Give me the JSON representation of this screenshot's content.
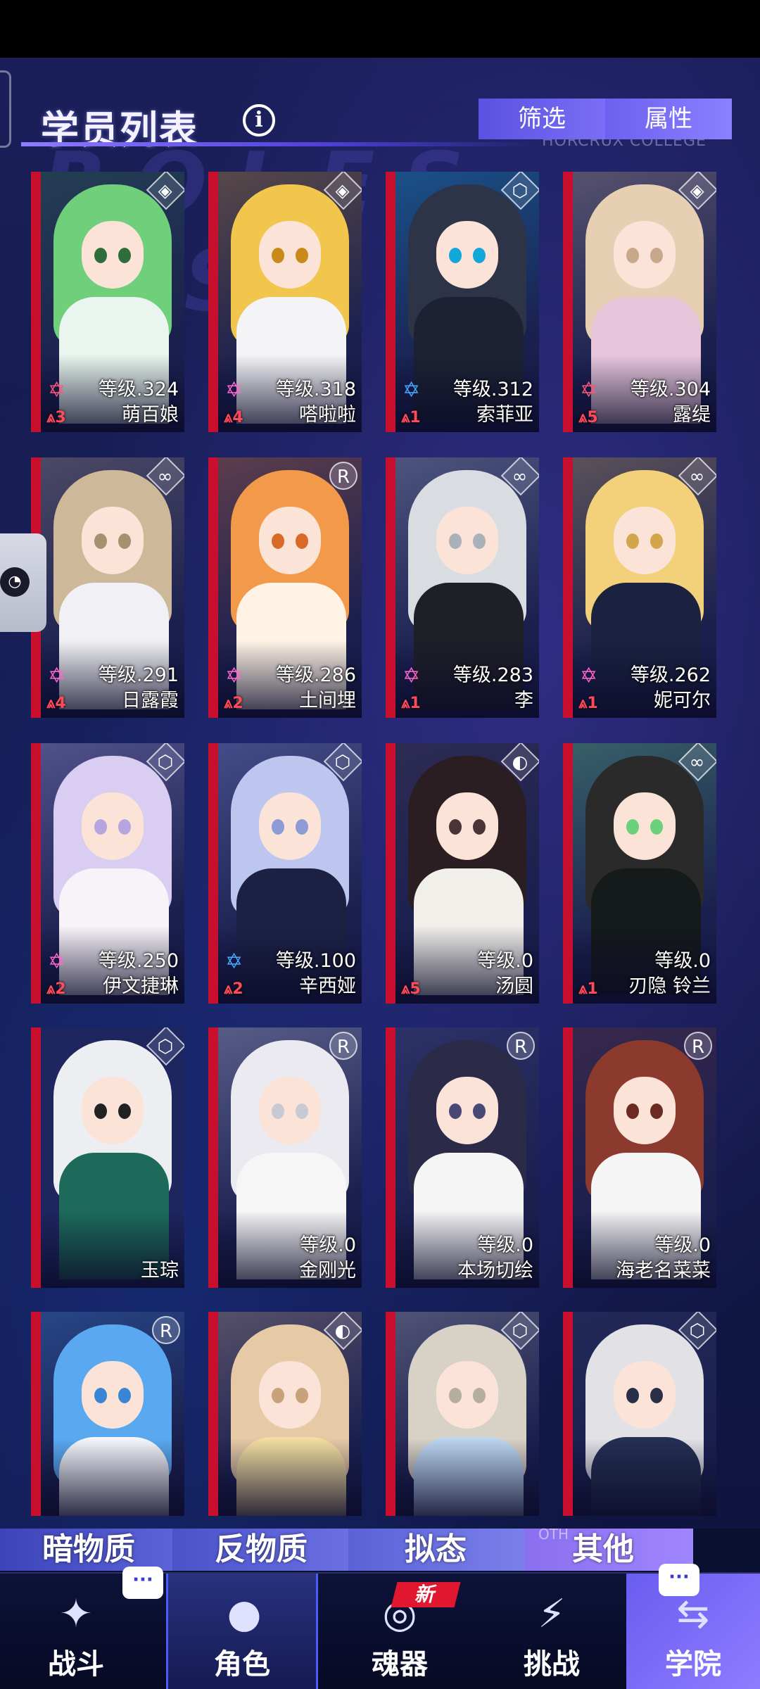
{
  "header": {
    "title": "学员列表",
    "info_icon": "info-icon",
    "sub_text": "HORCRUX COLLEGE",
    "bg_text": "ROLES LIST",
    "filter_label": "筛选",
    "attribute_label": "属性"
  },
  "students": [
    {
      "level": "等级.324",
      "name": "萌百娘",
      "rank": "3",
      "type_icon": "◈",
      "star_color": "#ff5577"
    },
    {
      "level": "等级.318",
      "name": "嗒啦啦",
      "rank": "4",
      "type_icon": "◈",
      "star_color": "#ff66cc"
    },
    {
      "level": "等级.312",
      "name": "索菲亚",
      "rank": "1",
      "type_icon": "⬡",
      "star_color": "#44aaff"
    },
    {
      "level": "等级.304",
      "name": "露缇",
      "rank": "5",
      "type_icon": "◈",
      "star_color": "#ff5577"
    },
    {
      "level": "等级.291",
      "name": "日露霞",
      "rank": "4",
      "type_icon": "∞",
      "star_color": "#ff66cc"
    },
    {
      "level": "等级.286",
      "name": "土间埋",
      "rank": "2",
      "type_icon": "R",
      "star_color": "#ff66cc"
    },
    {
      "level": "等级.283",
      "name": "李",
      "rank": "1",
      "type_icon": "∞",
      "star_color": "#ff66cc"
    },
    {
      "level": "等级.262",
      "name": "妮可尔",
      "rank": "1",
      "type_icon": "∞",
      "star_color": "#ff66cc"
    },
    {
      "level": "等级.250",
      "name": "伊文捷琳",
      "rank": "2",
      "type_icon": "⬡",
      "star_color": "#ff66cc"
    },
    {
      "level": "等级.100",
      "name": "辛西娅",
      "rank": "2",
      "type_icon": "⬡",
      "star_color": "#44aaff"
    },
    {
      "level": "等级.0",
      "name": "汤圆",
      "rank": "5",
      "type_icon": "◐",
      "star_color": ""
    },
    {
      "level": "等级.0",
      "name": "刃隐 铃兰",
      "rank": "1",
      "type_icon": "∞",
      "star_color": ""
    },
    {
      "level": "",
      "name": "玉琮",
      "rank": "",
      "type_icon": "⬡",
      "star_color": ""
    },
    {
      "level": "等级.0",
      "name": "金刚光",
      "rank": "",
      "type_icon": "R",
      "star_color": ""
    },
    {
      "level": "等级.0",
      "name": "本场切绘",
      "rank": "",
      "type_icon": "R",
      "star_color": ""
    },
    {
      "level": "等级.0",
      "name": "海老名菜菜",
      "rank": "",
      "type_icon": "R",
      "star_color": ""
    },
    {
      "level": "",
      "name": "",
      "rank": "",
      "type_icon": "R",
      "star_color": ""
    },
    {
      "level": "",
      "name": "",
      "rank": "",
      "type_icon": "◐",
      "star_color": ""
    },
    {
      "level": "",
      "name": "",
      "rank": "",
      "type_icon": "⬡",
      "star_color": ""
    },
    {
      "level": "",
      "name": "",
      "rank": "",
      "type_icon": "⬡",
      "star_color": ""
    }
  ],
  "categories": {
    "dark_matter": "暗物质",
    "anti_matter": "反物质",
    "mimic": "拟态",
    "other": "其他",
    "other_tag": "OTH"
  },
  "nav": {
    "battle": "战斗",
    "role": "角色",
    "soul": "魂器",
    "challenge": "挑战",
    "college": "学院",
    "new_badge": "新",
    "chat_icon": "···"
  },
  "colors": {
    "accent": "#7b6df5",
    "card_border": "#c8102e",
    "rank_red": "#ff4a5a"
  }
}
